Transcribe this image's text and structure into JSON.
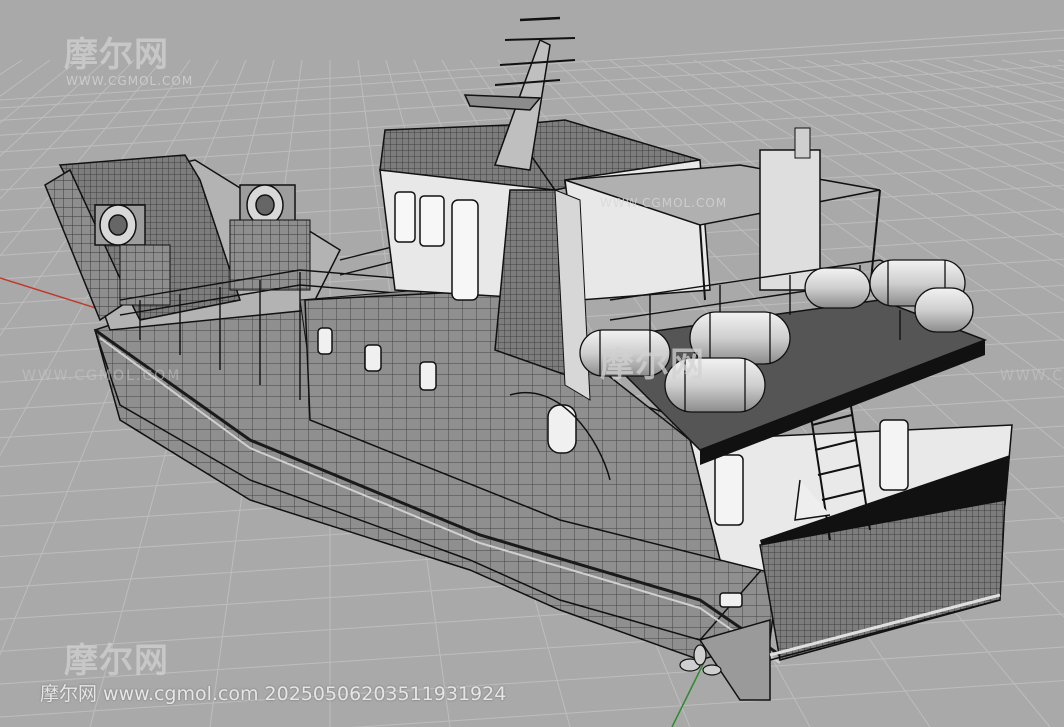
{
  "viewport": {
    "background": "#a9a9a9",
    "grid_color": "#bdbdbd",
    "axis_x_color": "#c0392b",
    "axis_y_color": "#2e8b2e"
  },
  "watermark": {
    "logo_text": "摩尔网",
    "logo_sub": "WWW.CGMOL.COM",
    "footer": "摩尔网 www.cgmol.com 20250506203511931924"
  }
}
